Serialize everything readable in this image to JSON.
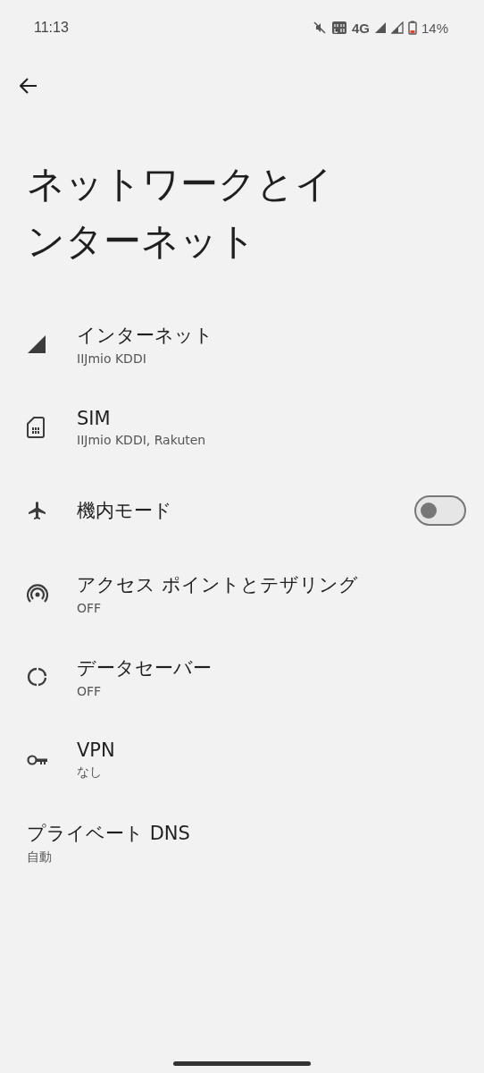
{
  "status_bar": {
    "time": "11:13",
    "network": "4G",
    "battery": "14%"
  },
  "title": "ネットワークとインターネット",
  "items": [
    {
      "kind": "signal",
      "title": "インターネット",
      "subtitle": "IIJmio KDDI"
    },
    {
      "kind": "sim",
      "title": "SIM",
      "subtitle": "IIJmio KDDI, Rakuten"
    },
    {
      "kind": "airplane",
      "title": "機内モード",
      "on": false
    },
    {
      "kind": "hotspot",
      "title": "アクセス ポイントとテザリング",
      "subtitle": "OFF"
    },
    {
      "kind": "datasaver",
      "title": "データセーバー",
      "subtitle": "OFF"
    },
    {
      "kind": "vpn",
      "title": "VPN",
      "subtitle": "なし"
    },
    {
      "kind": "plain",
      "title": "プライベート DNS",
      "subtitle": "自動"
    }
  ]
}
